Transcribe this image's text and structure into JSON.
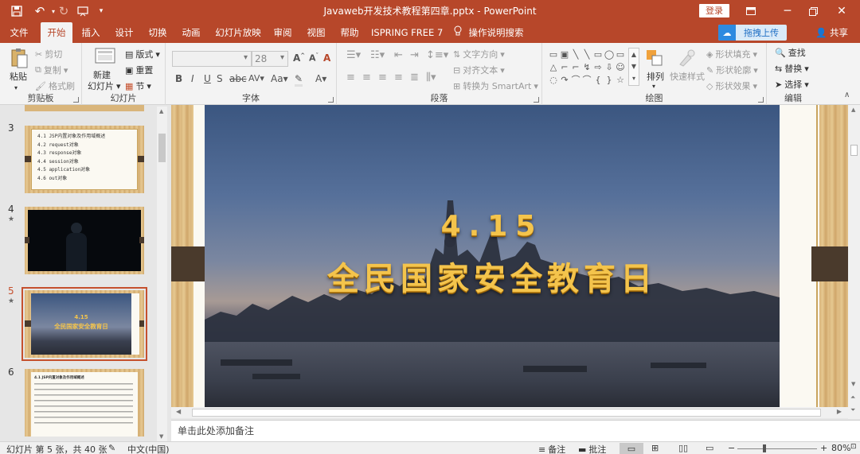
{
  "titlebar": {
    "title": "Javaweb开发技术教程第四章.pptx  -  PowerPoint",
    "login_label": "登录",
    "save_icon": "save-icon",
    "undo_icon": "undo-icon",
    "redo_icon": "redo-icon",
    "present_icon": "present-icon"
  },
  "tabs": [
    {
      "label": "文件"
    },
    {
      "label": "开始"
    },
    {
      "label": "插入"
    },
    {
      "label": "设计"
    },
    {
      "label": "切换"
    },
    {
      "label": "动画"
    },
    {
      "label": "幻灯片放映"
    },
    {
      "label": "审阅"
    },
    {
      "label": "视图"
    },
    {
      "label": "帮助"
    },
    {
      "label": "ISPRING FREE 7"
    },
    {
      "label": "操作说明搜索"
    }
  ],
  "upload_label": "拖拽上传",
  "share_label": "共享",
  "ribbon": {
    "clipboard": {
      "label": "剪贴板",
      "paste": "粘贴",
      "cut": "剪切",
      "copy": "复制",
      "format_painter": "格式刷"
    },
    "slides": {
      "label": "幻灯片",
      "new_slide": "新建",
      "new_slide2": "幻灯片",
      "layout": "版式",
      "reset": "重置",
      "section": "节"
    },
    "font": {
      "label": "字体",
      "font_size": "28"
    },
    "paragraph": {
      "label": "段落",
      "text_direction": "文字方向",
      "align_text": "对齐文本",
      "smartart": "转换为 SmartArt"
    },
    "drawing": {
      "label": "绘图",
      "arrange": "排列",
      "quick_styles": "快速样式",
      "fill": "形状填充",
      "outline": "形状轮廓",
      "effects": "形状效果"
    },
    "editing": {
      "label": "编辑",
      "find": "查找",
      "replace": "替换",
      "select": "选择"
    }
  },
  "thumbnails": {
    "s3": {
      "num": "3",
      "lines": [
        "4.1 JSP内置对象及作用域概述",
        "4.2 request对象",
        "4.3 response对象",
        "4.4 session对象",
        "4.5 application对象",
        "4.6 out对象"
      ]
    },
    "s4": {
      "num": "4"
    },
    "s5": {
      "num": "5",
      "title_small": "4.15",
      "sub_small": "全民国家安全教育日"
    },
    "s6": {
      "num": "6",
      "heading": "4.1 JSP内置对象及作用域概述"
    }
  },
  "slide": {
    "title": "4.15",
    "subtitle": "全民国家安全教育日"
  },
  "notes_placeholder": "单击此处添加备注",
  "status": {
    "slide_count": "幻灯片 第 5 张，共 40 张",
    "language": "中文(中国)",
    "notes": "备注",
    "comments": "批注",
    "zoom": "80%"
  }
}
